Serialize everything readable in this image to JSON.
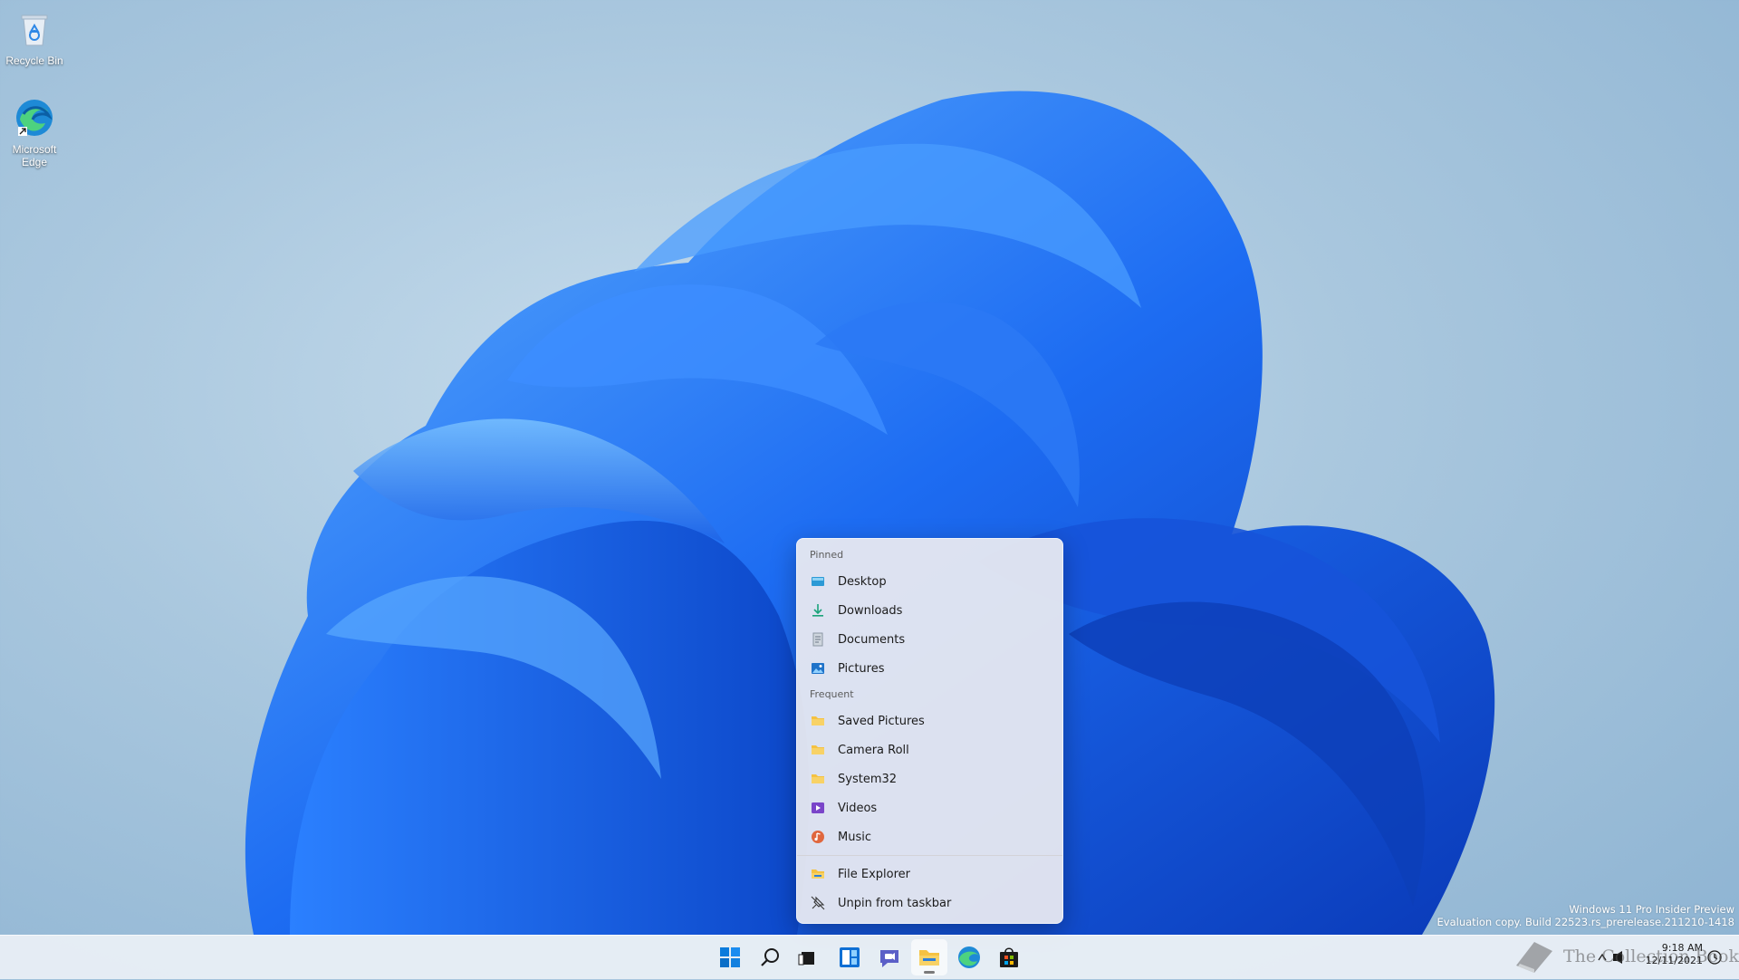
{
  "desktop": {
    "icons": [
      {
        "label": "Recycle Bin",
        "icon": "recycle-bin-icon"
      },
      {
        "label": "Microsoft Edge",
        "icon": "edge-icon"
      }
    ]
  },
  "jumplist": {
    "pinned_header": "Pinned",
    "pinned": [
      {
        "label": "Desktop",
        "icon": "desktop-icon"
      },
      {
        "label": "Downloads",
        "icon": "download-icon"
      },
      {
        "label": "Documents",
        "icon": "document-icon"
      },
      {
        "label": "Pictures",
        "icon": "pictures-icon"
      }
    ],
    "frequent_header": "Frequent",
    "frequent": [
      {
        "label": "Saved Pictures",
        "icon": "folder-icon"
      },
      {
        "label": "Camera Roll",
        "icon": "folder-icon"
      },
      {
        "label": "System32",
        "icon": "folder-icon"
      },
      {
        "label": "Videos",
        "icon": "videos-icon"
      },
      {
        "label": "Music",
        "icon": "music-icon"
      }
    ],
    "actions": [
      {
        "label": "File Explorer",
        "icon": "file-explorer-icon"
      },
      {
        "label": "Unpin from taskbar",
        "icon": "unpin-icon"
      }
    ]
  },
  "taskbar": {
    "apps": [
      "start-icon",
      "search-icon",
      "task-view-icon",
      "widgets-icon",
      "chat-icon",
      "file-explorer-icon",
      "edge-icon",
      "store-icon"
    ],
    "active_app": "file-explorer-icon"
  },
  "watermark": {
    "line1": "Windows 11 Pro Insider Preview",
    "line2": "Evaluation copy. Build 22523.rs_prerelease.211210-1418"
  },
  "clock": {
    "time": "9:18 AM",
    "date": "12/11/2021"
  },
  "brand": {
    "text": "The Collection Book"
  },
  "colors": {
    "accent": "#0067c0",
    "bloom": "#1f6ff0",
    "folder": "#f5c242"
  }
}
